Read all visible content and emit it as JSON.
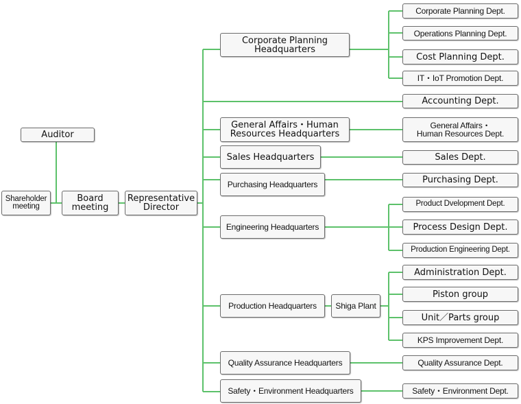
{
  "title": "Organization Chart",
  "line_color": "#5cc16a",
  "governance": {
    "auditor": "Auditor",
    "shareholder_meeting": "Shareholder\nmeeting",
    "board_meeting": "Board\nmeeting",
    "representative_director": "Representative\nDirector"
  },
  "headquarters": [
    {
      "name": "Corporate Planning\nHeadquarters",
      "departments": [
        "Corporate Planning Dept.",
        "Operations Planning Dept.",
        "Cost Planning Dept.",
        "IT・IoT Promotion Dept."
      ]
    },
    {
      "name": null,
      "departments": [
        "Accounting Dept."
      ]
    },
    {
      "name": "General Affairs・Human\nResources Headquarters",
      "departments": [
        "General Affairs・\nHuman Resources Dept."
      ]
    },
    {
      "name": "Sales Headquarters",
      "departments": [
        "Sales Dept."
      ]
    },
    {
      "name": "Purchasing Headquarters",
      "departments": [
        "Purchasing Dept."
      ]
    },
    {
      "name": "Engineering Headquarters",
      "departments": [
        "Product Dvelopment Dept.",
        "Process Design Dept.",
        "Production Engineering Dept."
      ]
    },
    {
      "name": "Production Headquarters",
      "plant": "Shiga Plant",
      "departments": [
        "Administration Dept.",
        "Piston group",
        "Unit／Parts group",
        "KPS Improvement Dept."
      ]
    },
    {
      "name": "Quality Assurance Headquarters",
      "departments": [
        "Quality Assurance Dept."
      ]
    },
    {
      "name": "Safety・Environment Headquarters",
      "departments": [
        "Safety・Environment Dept."
      ]
    }
  ]
}
